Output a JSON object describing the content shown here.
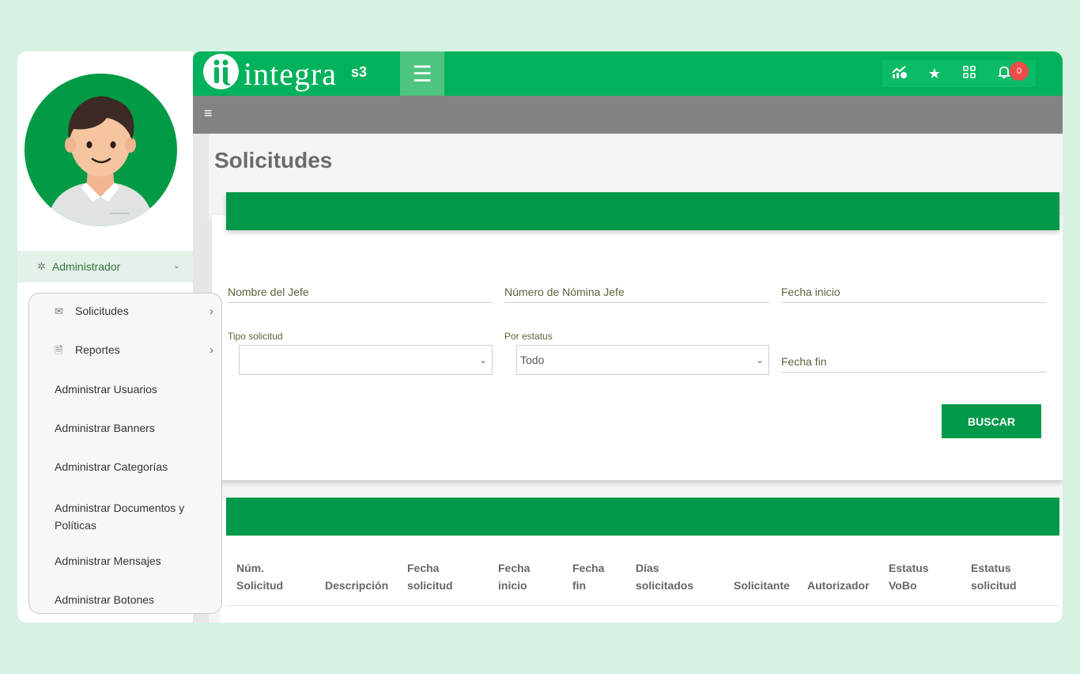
{
  "app": {
    "logo_text": "integra",
    "logo_sup": "s3",
    "notification_count": "0"
  },
  "sidebar": {
    "admin_label": "Administrador",
    "submenu": [
      {
        "label": "Solicitudes",
        "icon": "envelope-icon",
        "has_arrow": true
      },
      {
        "label": "Reportes",
        "icon": "document-icon",
        "has_arrow": true
      },
      {
        "label": "Administrar Usuarios"
      },
      {
        "label": "Administrar Banners"
      },
      {
        "label": "Administrar Categorías"
      },
      {
        "label": "Administrar Documentos y Políticas"
      },
      {
        "label": "Administrar Mensajes"
      },
      {
        "label": "Administrar Botones"
      }
    ]
  },
  "page": {
    "title": "Solicitudes"
  },
  "filters": {
    "jefe_label": "Nombre del Jefe",
    "nomina_label": "Número de Nómina Jefe",
    "fecha_inicio_label": "Fecha inicio",
    "tipo_label": "Tipo solicitud",
    "tipo_value": "",
    "estatus_label": "Por estatus",
    "estatus_value": "Todo",
    "fecha_fin_label": "Fecha fin",
    "buscar_label": "BUSCAR"
  },
  "table": {
    "headers": [
      "Núm. Solicitud",
      "Descripción",
      "Fecha solicitud",
      "Fecha inicio",
      "Fecha fin",
      "Días solicitados",
      "Solicitante",
      "Autorizador",
      "Estatus VoBo",
      "Estatus solicitud"
    ]
  },
  "colors": {
    "brand_green": "#02b15c",
    "header_green": "#02994a",
    "badge_red": "#ee4b4b"
  }
}
